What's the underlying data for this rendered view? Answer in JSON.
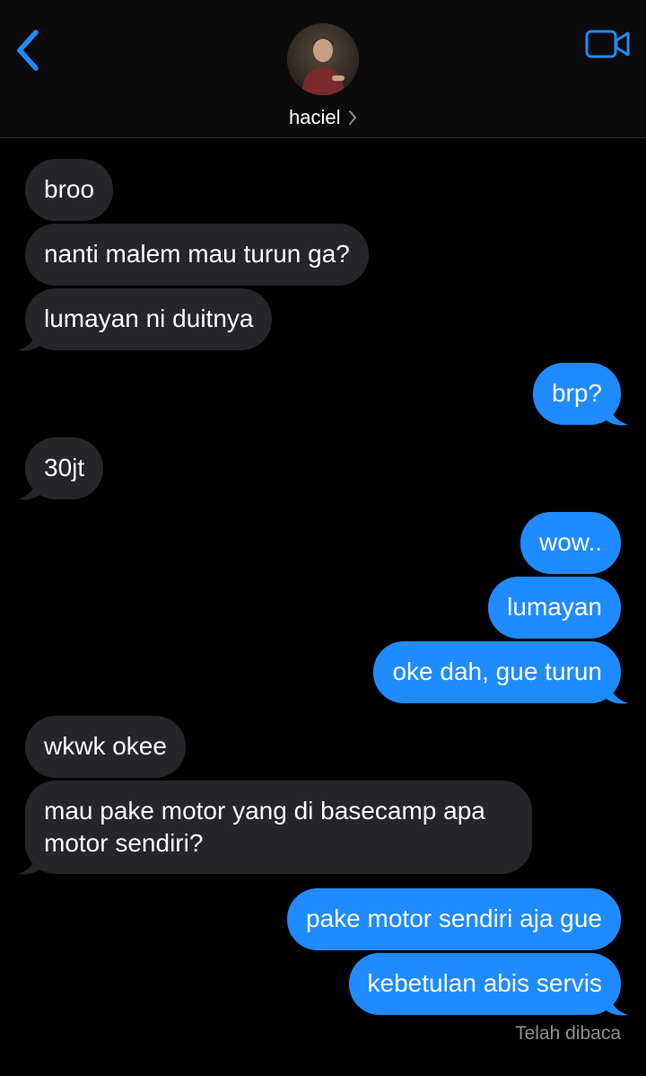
{
  "contact": {
    "name": "haciel"
  },
  "messages": [
    {
      "from": "them",
      "text": "broo"
    },
    {
      "from": "them",
      "text": "nanti malem mau turun ga?"
    },
    {
      "from": "them",
      "text": "lumayan ni duitnya"
    },
    {
      "from": "me",
      "text": "brp?"
    },
    {
      "from": "them",
      "text": "30jt"
    },
    {
      "from": "me",
      "text": "wow.."
    },
    {
      "from": "me",
      "text": "lumayan"
    },
    {
      "from": "me",
      "text": "oke dah, gue turun"
    },
    {
      "from": "them",
      "text": "wkwk okee"
    },
    {
      "from": "them",
      "text": "mau pake motor yang di basecamp apa motor sendiri?"
    },
    {
      "from": "me",
      "text": "pake motor sendiri aja gue"
    },
    {
      "from": "me",
      "text": "kebetulan abis servis"
    }
  ],
  "read_status": "Telah dibaca",
  "icons": {
    "back": "chevron-left-icon",
    "video": "video-camera-icon",
    "disclosure": "chevron-right-icon"
  },
  "colors": {
    "accent": "#1f8bff",
    "incoming_bubble": "#26252a",
    "background": "#000000"
  }
}
